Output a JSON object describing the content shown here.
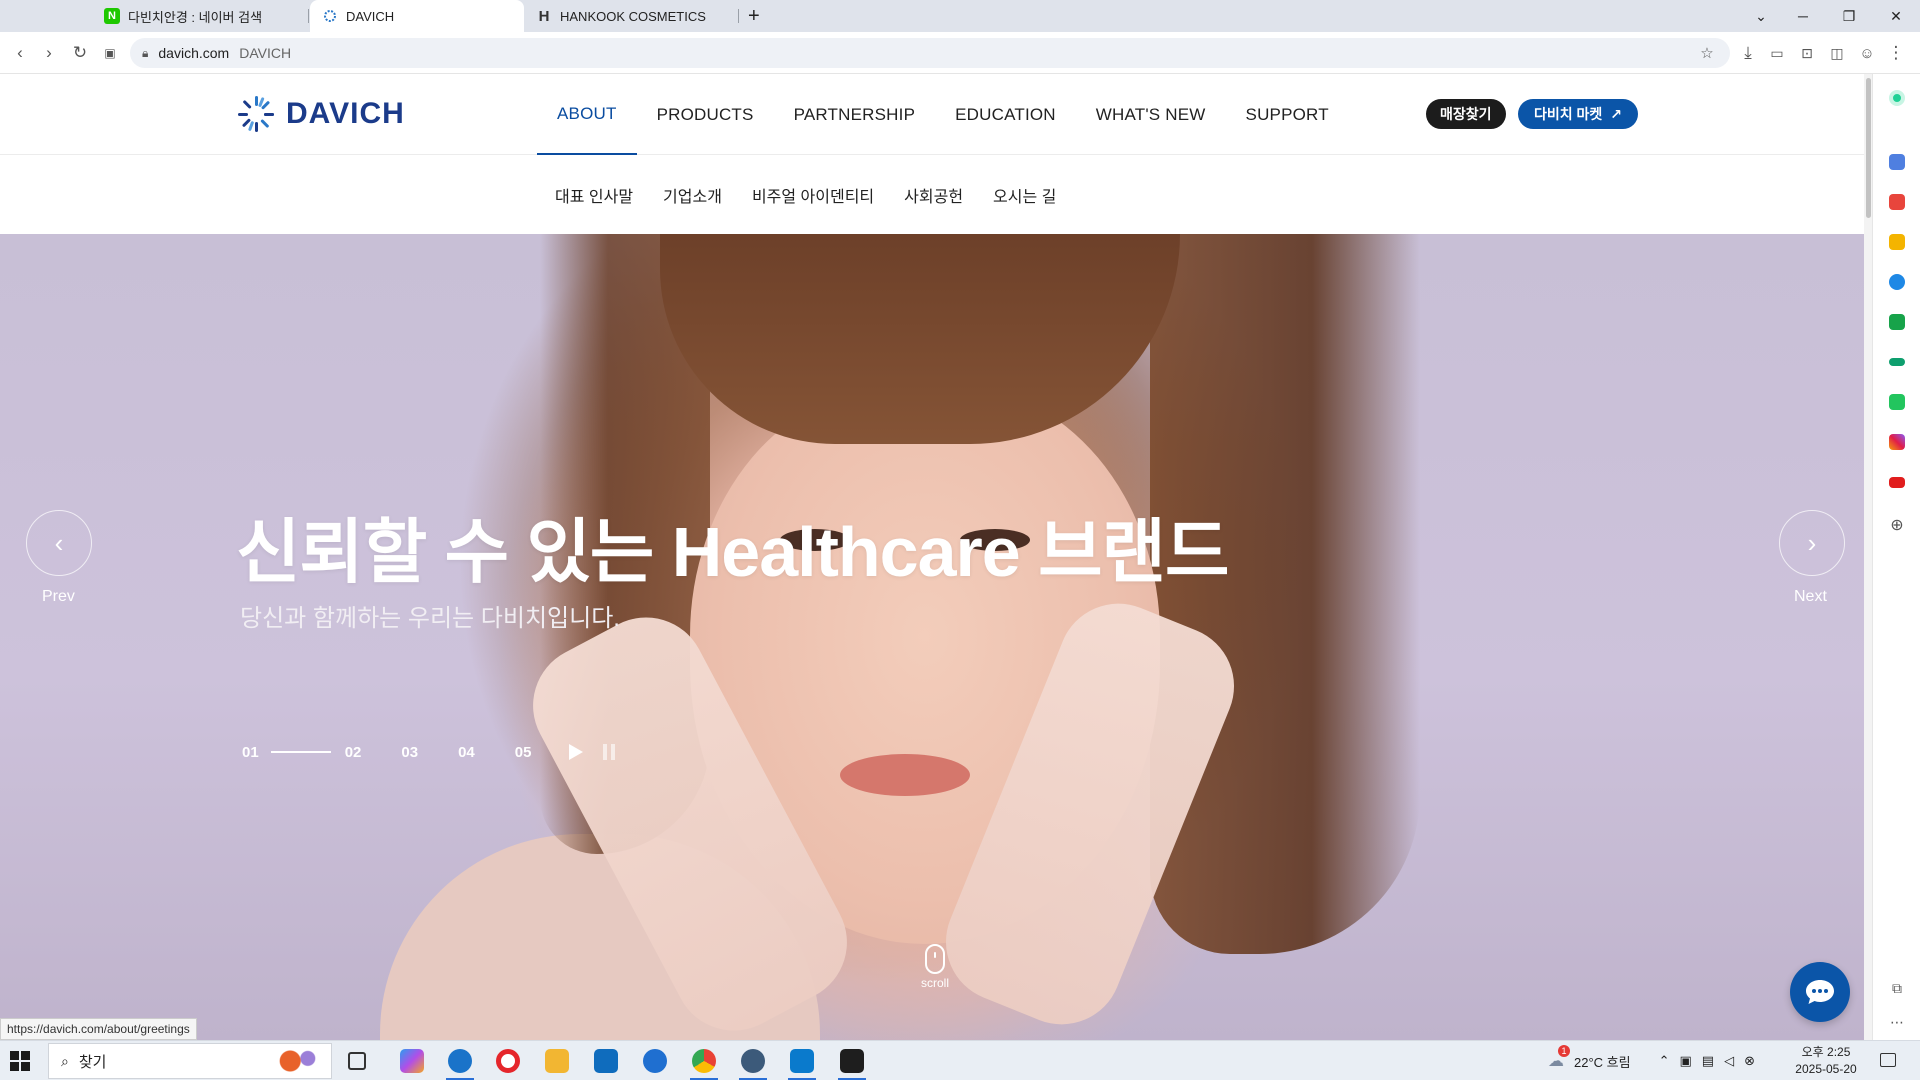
{
  "browser": {
    "tabs": [
      {
        "title": "다빈치안경 : 네이버 검색",
        "favicon": "N",
        "active": false
      },
      {
        "title": "DAVICH",
        "active": true
      },
      {
        "title": "HANKOOK COSMETICS",
        "favicon": "H",
        "active": false
      }
    ],
    "new_tab": "+",
    "address": {
      "url": "davich.com",
      "page_title": "DAVICH"
    },
    "status_url": "https://davich.com/about/greetings"
  },
  "site": {
    "logo_text": "DAVICH",
    "main_nav": [
      "ABOUT",
      "PRODUCTS",
      "PARTNERSHIP",
      "EDUCATION",
      "WHAT'S NEW",
      "SUPPORT"
    ],
    "active_nav": "ABOUT",
    "store_button": "매장찾기",
    "market_button": "다비치 마켓",
    "sub_nav": [
      "대표 인사말",
      "기업소개",
      "비주얼 아이덴티티",
      "사회공헌",
      "오시는 길"
    ]
  },
  "hero": {
    "title": "신뢰할 수 있는 Healthcare 브랜드",
    "subtitle": "당신과 함께하는 우리는 다비치입니다.",
    "prev_label": "Prev",
    "next_label": "Next",
    "slides": [
      "01",
      "02",
      "03",
      "04",
      "05"
    ],
    "current_slide": "01",
    "scroll_label": "scroll"
  },
  "taskbar": {
    "search_placeholder": "찾기",
    "weather": "22°C  흐림",
    "weather_badge": "1",
    "time": "오후 2:25",
    "date": "2025-05-20"
  },
  "colors": {
    "brand_blue": "#0b55a8",
    "logo_navy": "#1b3b8a",
    "active_nav": "#0a4ca0"
  }
}
